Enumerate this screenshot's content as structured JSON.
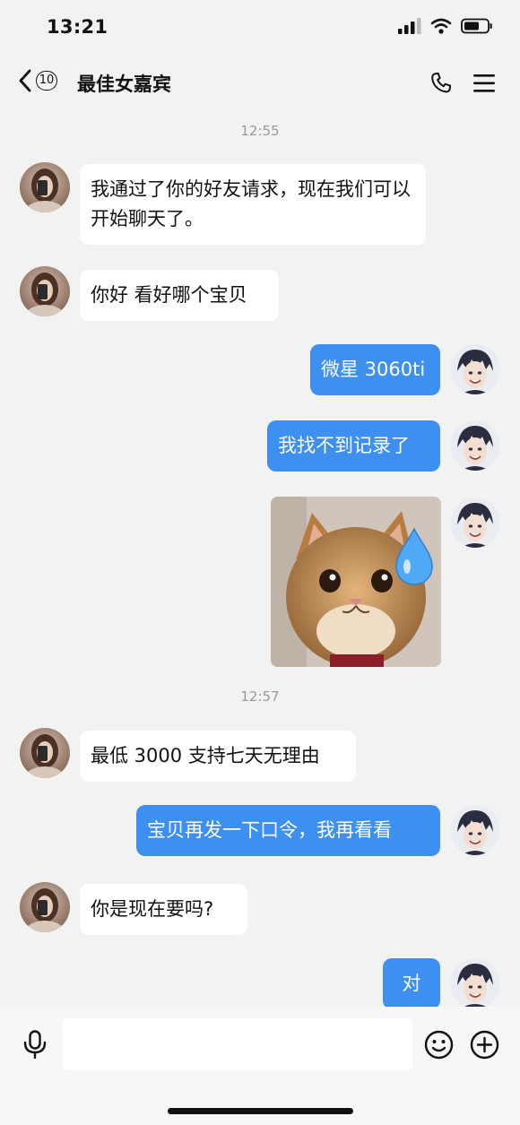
{
  "status": {
    "time": "13:21"
  },
  "header": {
    "unread_count": "10",
    "title": "最佳女嘉宾"
  },
  "messages": {
    "ts1": "12:55",
    "m1": "我通过了你的好友请求，现在我们可以开始聊天了。",
    "m2": "你好 看好哪个宝贝",
    "m3": "微星 3060ti",
    "m4": "我找不到记录了",
    "ts2": "12:57",
    "m6": "最低 3000 支持七天无理由",
    "m7": "宝贝再发一下口令，我再看看",
    "m8": "你是现在要吗?",
    "m9": "对"
  },
  "input": {
    "value": ""
  },
  "colors": {
    "outgoing_bubble": "#3d8ff0",
    "incoming_bubble": "#ffffff",
    "background": "#f2f2f2"
  },
  "icons": [
    "back-arrow-icon",
    "phone-icon",
    "menu-icon",
    "signal-icon",
    "wifi-icon",
    "battery-icon",
    "microphone-icon",
    "emoji-icon",
    "plus-icon",
    "water-drop-icon"
  ]
}
